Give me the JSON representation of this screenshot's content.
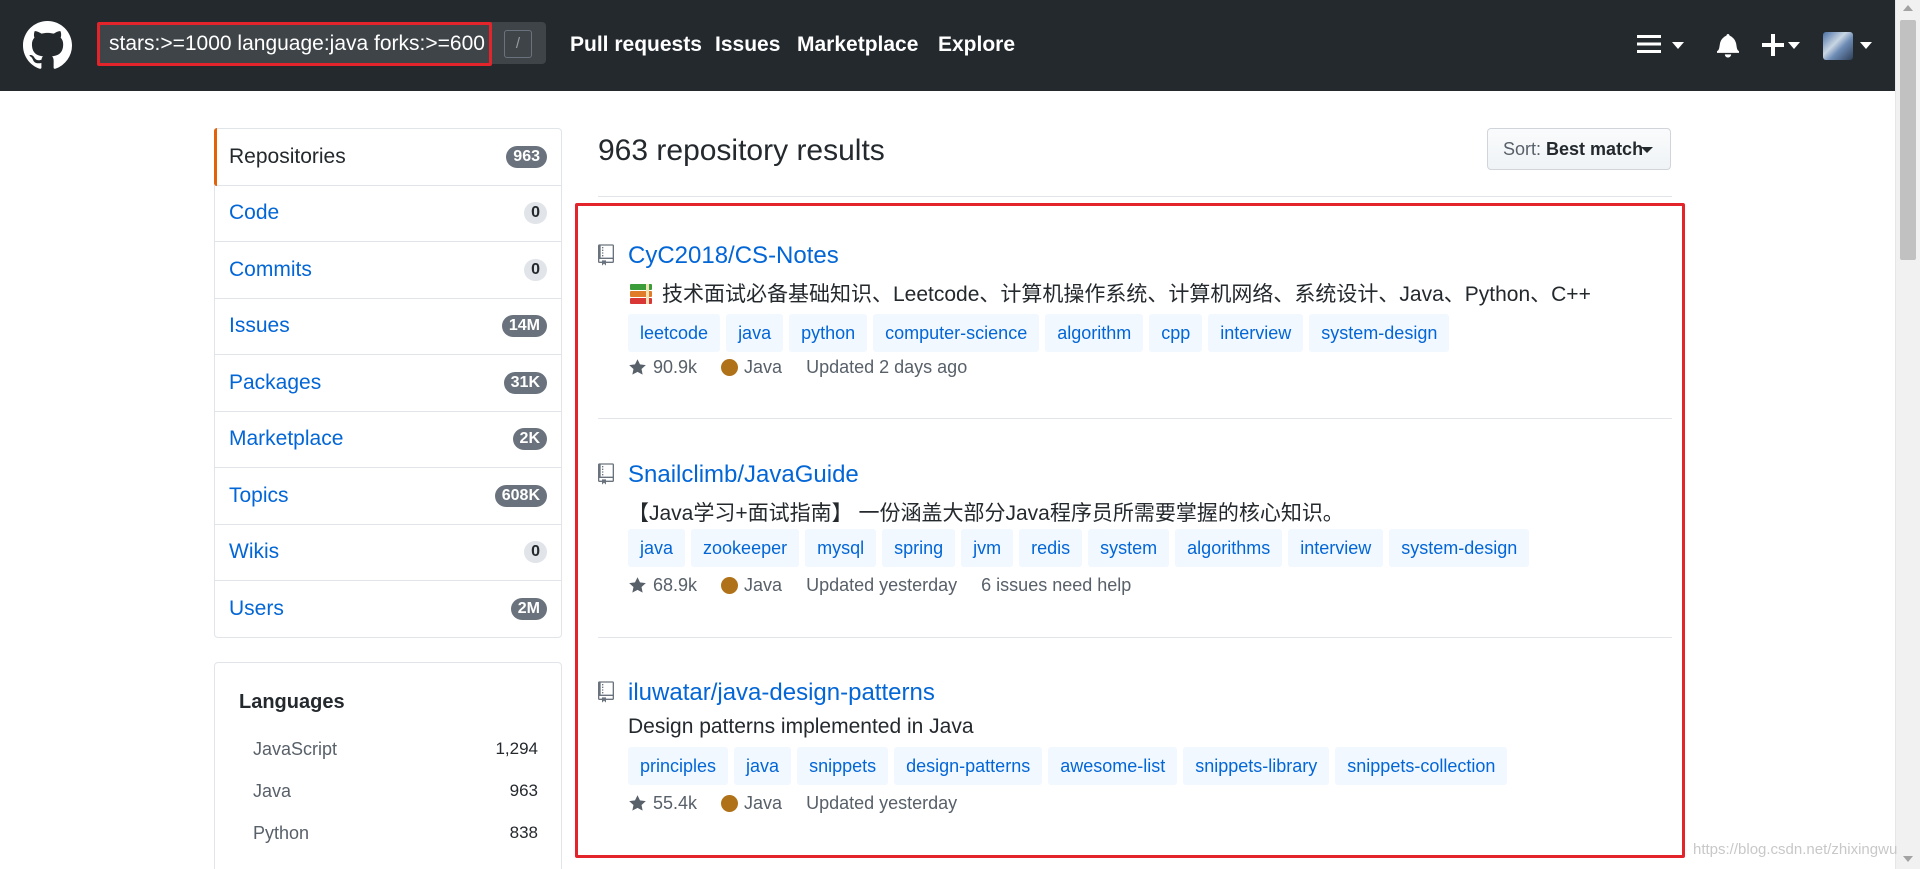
{
  "header": {
    "search_value": "stars:>=1000 language:java forks:>=600",
    "slash_hint": "/",
    "nav": [
      "Pull requests",
      "Issues",
      "Marketplace",
      "Explore"
    ]
  },
  "sidebar": {
    "items": [
      {
        "label": "Repositories",
        "count": "963"
      },
      {
        "label": "Code",
        "count": "0"
      },
      {
        "label": "Commits",
        "count": "0"
      },
      {
        "label": "Issues",
        "count": "14M"
      },
      {
        "label": "Packages",
        "count": "31K"
      },
      {
        "label": "Marketplace",
        "count": "2K"
      },
      {
        "label": "Topics",
        "count": "608K"
      },
      {
        "label": "Wikis",
        "count": "0"
      },
      {
        "label": "Users",
        "count": "2M"
      }
    ],
    "languages_title": "Languages",
    "languages": [
      {
        "name": "JavaScript",
        "count": "1,294"
      },
      {
        "name": "Java",
        "count": "963"
      },
      {
        "name": "Python",
        "count": "838"
      }
    ]
  },
  "results": {
    "title": "963 repository results",
    "sort_label": "Sort:",
    "sort_value": "Best match",
    "repos": [
      {
        "name": "CyC2018/CS-Notes",
        "description": "技术面试必备基础知识、Leetcode、计算机操作系统、计算机网络、系统设计、Java、Python、C++",
        "topics": [
          "leetcode",
          "java",
          "python",
          "computer-science",
          "algorithm",
          "cpp",
          "interview",
          "system-design"
        ],
        "stars": "90.9k",
        "language": "Java",
        "updated": "Updated 2 days ago",
        "extra": ""
      },
      {
        "name": "Snailclimb/JavaGuide",
        "description": "【Java学习+面试指南】 一份涵盖大部分Java程序员所需要掌握的核心知识。",
        "topics": [
          "java",
          "zookeeper",
          "mysql",
          "spring",
          "jvm",
          "redis",
          "system",
          "algorithms",
          "interview",
          "system-design"
        ],
        "stars": "68.9k",
        "language": "Java",
        "updated": "Updated yesterday",
        "extra": "6 issues need help"
      },
      {
        "name": "iluwatar/java-design-patterns",
        "description": "Design patterns implemented in Java",
        "topics": [
          "principles",
          "java",
          "snippets",
          "design-patterns",
          "awesome-list",
          "snippets-library",
          "snippets-collection"
        ],
        "stars": "55.4k",
        "language": "Java",
        "updated": "Updated yesterday",
        "extra": ""
      }
    ]
  },
  "colors": {
    "header_bg": "#24292e",
    "link": "#0366d6",
    "highlight_border": "#e3242b",
    "java_dot": "#b07219",
    "topic_bg": "#f1f8ff"
  },
  "icons": [
    "github-logo-icon",
    "menu-icon",
    "bell-icon",
    "plus-icon",
    "repo-icon",
    "star-icon",
    "books-emoji-icon"
  ],
  "watermark": "https://blog.csdn.net/zhixingwu"
}
